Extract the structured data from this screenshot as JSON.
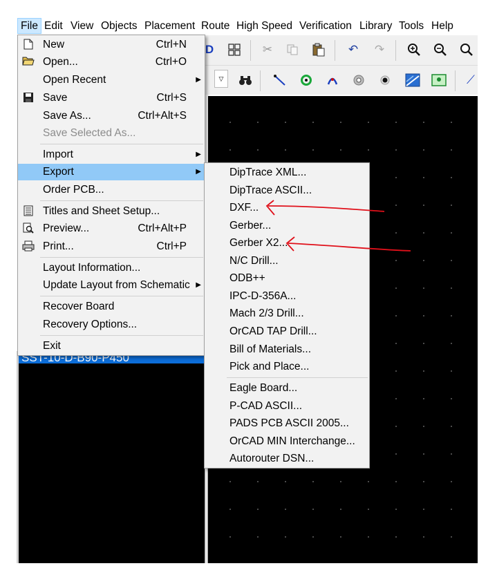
{
  "menubar": {
    "items": [
      "File",
      "Edit",
      "View",
      "Objects",
      "Placement",
      "Route",
      "High Speed",
      "Verification",
      "Library",
      "Tools",
      "Help"
    ]
  },
  "file_menu": {
    "new": {
      "label": "New",
      "shortcut": "Ctrl+N"
    },
    "open": {
      "label": "Open...",
      "shortcut": "Ctrl+O"
    },
    "open_recent": {
      "label": "Open Recent"
    },
    "save": {
      "label": "Save",
      "shortcut": "Ctrl+S"
    },
    "save_as": {
      "label": "Save As...",
      "shortcut": "Ctrl+Alt+S"
    },
    "save_selected_as": {
      "label": "Save Selected As..."
    },
    "import": {
      "label": "Import"
    },
    "export": {
      "label": "Export"
    },
    "order_pcb": {
      "label": "Order PCB..."
    },
    "titles": {
      "label": "Titles and Sheet Setup..."
    },
    "preview": {
      "label": "Preview...",
      "shortcut": "Ctrl+Alt+P"
    },
    "print": {
      "label": "Print...",
      "shortcut": "Ctrl+P"
    },
    "layout_info": {
      "label": "Layout Information..."
    },
    "update_layout": {
      "label": "Update Layout from Schematic"
    },
    "recover_board": {
      "label": "Recover Board"
    },
    "recovery_options": {
      "label": "Recovery Options..."
    },
    "exit": {
      "label": "Exit"
    }
  },
  "export_menu": {
    "items": [
      "DipTrace XML...",
      "DipTrace ASCII...",
      "DXF...",
      "Gerber...",
      "Gerber X2...",
      "N/C Drill...",
      "ODB++",
      "IPC-D-356A...",
      "Mach 2/3 Drill...",
      "OrCAD TAP Drill...",
      "Bill of Materials...",
      "Pick and Place...",
      "Eagle Board...",
      "P-CAD ASCII...",
      "PADS PCB ASCII 2005...",
      "OrCAD MIN Interchange...",
      "Autorouter DSN..."
    ]
  },
  "left_panel": {
    "selected_row": "SST-10-D-B90-P450"
  },
  "colors": {
    "annotation_arrow": "#e0101a",
    "highlight": "#91c9f7",
    "selection": "#0c6dd8",
    "canvas": "#000000"
  }
}
